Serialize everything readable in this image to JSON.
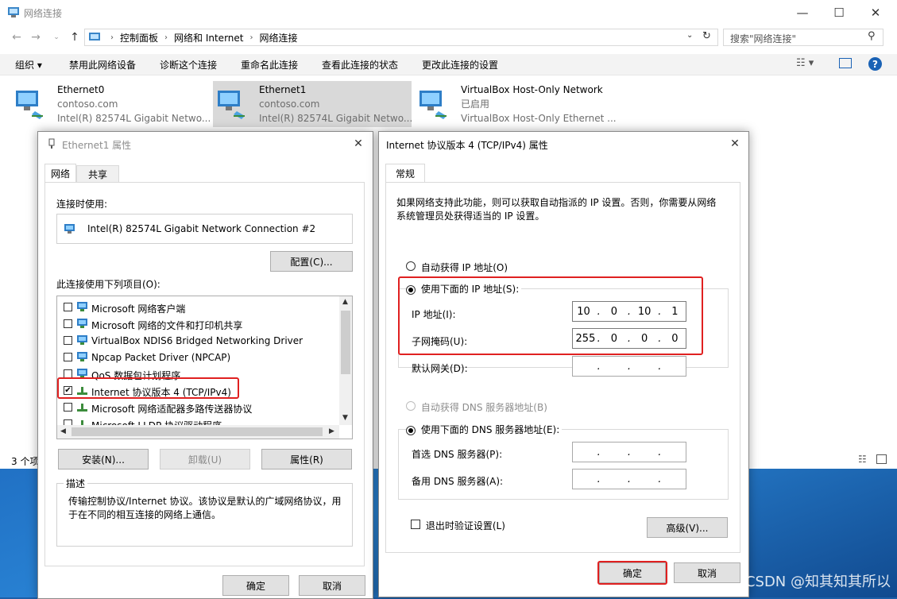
{
  "explorer": {
    "title": "网络连接",
    "breadcrumb": [
      "控制面板",
      "网络和 Internet",
      "网络连接"
    ],
    "search_placeholder": "搜索\"网络连接\"",
    "toolbar": [
      "组织 ▾",
      "禁用此网络设备",
      "诊断这个连接",
      "重命名此连接",
      "查看此连接的状态",
      "更改此连接的设置"
    ],
    "adapters": [
      {
        "name": "Ethernet0",
        "domain": "contoso.com",
        "device": "Intel(R) 82574L Gigabit Netwo..."
      },
      {
        "name": "Ethernet1",
        "domain": "contoso.com",
        "device": "Intel(R) 82574L Gigabit Netwo..."
      },
      {
        "name": "VirtualBox Host-Only Network",
        "domain": "已启用",
        "device": "VirtualBox Host-Only Ethernet ..."
      }
    ],
    "status": "3 个项"
  },
  "eth_dialog": {
    "title": "Ethernet1 属性",
    "tabs": [
      "网络",
      "共享"
    ],
    "connect_using_label": "连接时使用:",
    "adapter_name": "Intel(R) 82574L Gigabit Network Connection #2",
    "configure_button": "配置(C)...",
    "items_label": "此连接使用下列项目(O):",
    "items": [
      {
        "label": "Microsoft 网络客户端",
        "checked": false
      },
      {
        "label": "Microsoft 网络的文件和打印机共享",
        "checked": false
      },
      {
        "label": "VirtualBox NDIS6 Bridged Networking Driver",
        "checked": false
      },
      {
        "label": "Npcap Packet Driver (NPCAP)",
        "checked": false
      },
      {
        "label": "QoS 数据包计划程序",
        "checked": false
      },
      {
        "label": "Internet 协议版本 4 (TCP/IPv4)",
        "checked": true
      },
      {
        "label": "Microsoft 网络适配器多路传送器协议",
        "checked": false
      },
      {
        "label": "Microsoft LLDP 协议驱动程序",
        "checked": false
      }
    ],
    "install_button": "安装(N)...",
    "uninstall_button": "卸载(U)",
    "properties_button": "属性(R)",
    "description_label": "描述",
    "description_text": "传输控制协议/Internet 协议。该协议是默认的广域网络协议，用于在不同的相互连接的网络上通信。",
    "ok_button": "确定",
    "cancel_button": "取消"
  },
  "ipv4_dialog": {
    "title": "Internet 协议版本 4 (TCP/IPv4) 属性",
    "tab": "常规",
    "intro": "如果网络支持此功能，则可以获取自动指派的 IP 设置。否则，你需要从网络系统管理员处获得适当的 IP 设置。",
    "auto_ip_label": "自动获得 IP 地址(O)",
    "manual_ip_label": "使用下面的 IP 地址(S):",
    "ip_label": "IP 地址(I):",
    "ip_value": [
      "10",
      "0",
      "10",
      "1"
    ],
    "mask_label": "子网掩码(U):",
    "mask_value": [
      "255",
      "0",
      "0",
      "0"
    ],
    "gateway_label": "默认网关(D):",
    "auto_dns_label": "自动获得 DNS 服务器地址(B)",
    "manual_dns_label": "使用下面的 DNS 服务器地址(E):",
    "preferred_dns_label": "首选 DNS 服务器(P):",
    "alternate_dns_label": "备用 DNS 服务器(A):",
    "validate_label": "退出时验证设置(L)",
    "advanced_button": "高级(V)...",
    "ok_button": "确定",
    "cancel_button": "取消"
  },
  "watermark": "CSDN @知其知其所以"
}
